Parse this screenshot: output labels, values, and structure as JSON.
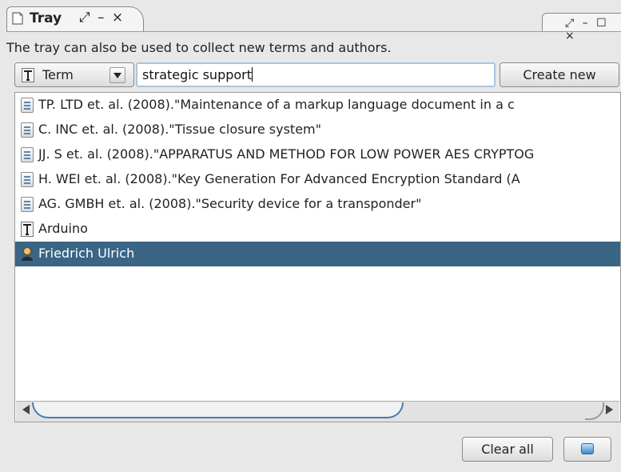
{
  "tab": {
    "title": "Tray",
    "controls": "⤢ – ×"
  },
  "window_controls": "⤢ – ☐ ×",
  "hint": "The tray can also be used to collect new terms and authors.",
  "toolbar": {
    "type_label": "Term",
    "search_value": "strategic support",
    "create_label": "Create new"
  },
  "list": {
    "items": [
      {
        "type": "document",
        "text": "TP. LTD et. al. (2008).\"Maintenance of a markup language document in a c"
      },
      {
        "type": "document",
        "text": "C. INC et. al. (2008).\"Tissue closure system\""
      },
      {
        "type": "document",
        "text": "JJ. S et. al. (2008).\"APPARATUS AND METHOD FOR LOW POWER AES CRYPTOG"
      },
      {
        "type": "document",
        "text": "H. WEI et. al. (2008).\"Key Generation For Advanced Encryption Standard (A"
      },
      {
        "type": "document",
        "text": "AG. GMBH et. al. (2008).\"Security device for a transponder\""
      },
      {
        "type": "term",
        "text": "Arduino"
      },
      {
        "type": "author",
        "text": "Friedrich Ulrich",
        "selected": true
      }
    ]
  },
  "footer": {
    "clear_label": "Clear all"
  },
  "colors": {
    "selection": "#3a6585",
    "focus_border": "#a9c4e0",
    "scroll_accent": "#4a7cab"
  }
}
